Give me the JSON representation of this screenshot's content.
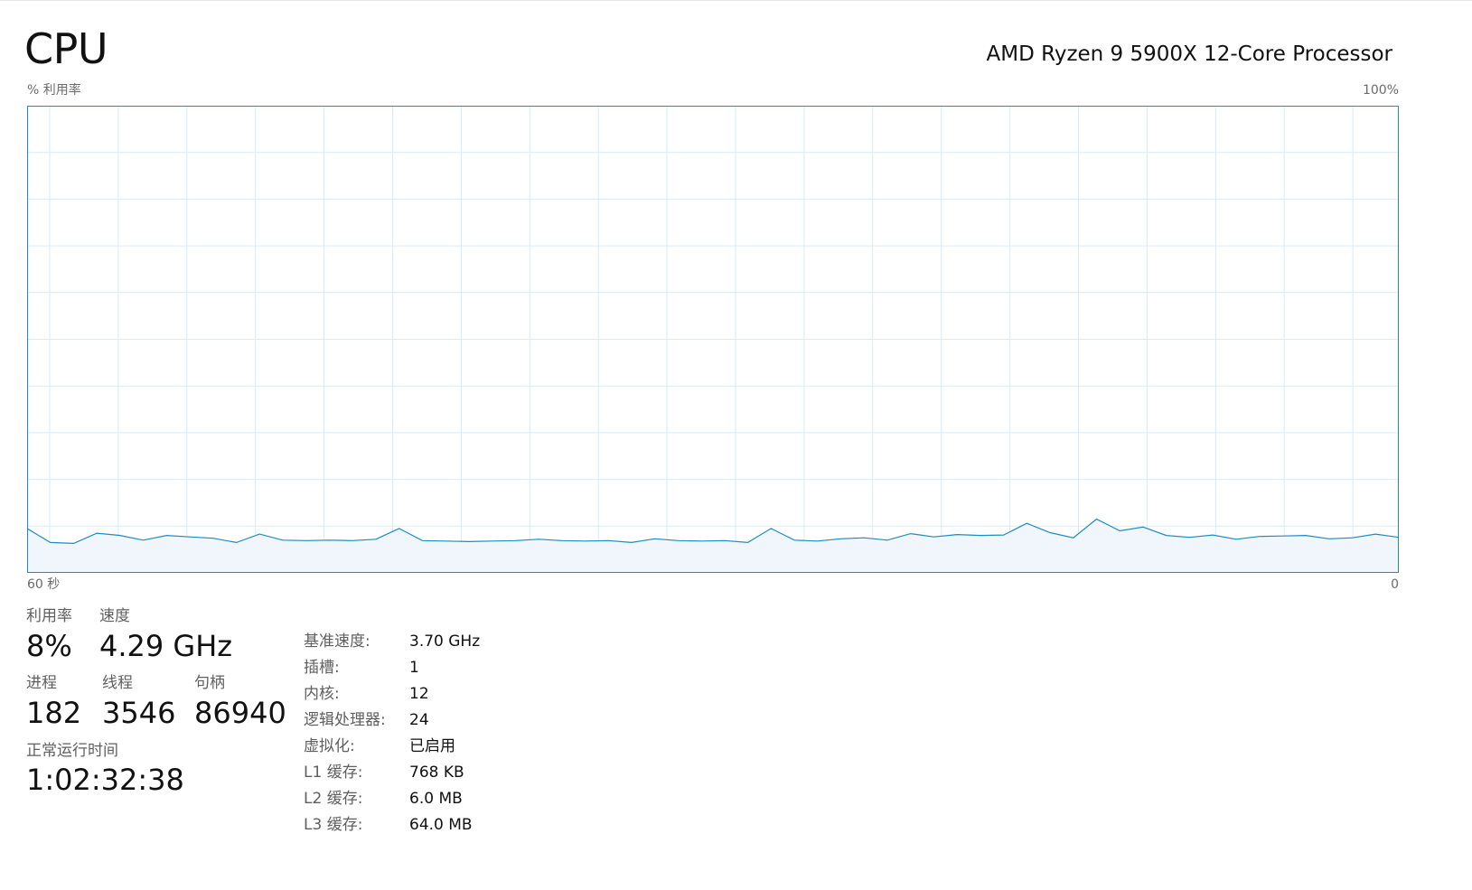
{
  "header": {
    "title": "CPU",
    "processor_name": "AMD Ryzen 9 5900X 12-Core Processor"
  },
  "graph": {
    "y_label": "% 利用率",
    "y_max_label": "100%",
    "x_left_label": "60 秒",
    "x_right_label": "0",
    "line_color": "#1c8cc4",
    "fill_color": "#f0f6fb",
    "grid_color": "#d9ebf5",
    "border_color": "#1c8cc4",
    "y_range": [
      0,
      100
    ],
    "x_range_seconds": [
      60,
      0
    ],
    "grid_rows": 10,
    "grid_cols": 20,
    "samples": [
      9.5,
      6.5,
      6.3,
      8.5,
      8.0,
      7.0,
      8.0,
      7.7,
      7.4,
      6.5,
      8.3,
      7.0,
      6.9,
      7.0,
      6.9,
      7.2,
      9.5,
      6.9,
      6.8,
      6.7,
      6.8,
      6.9,
      7.2,
      6.9,
      6.8,
      6.9,
      6.5,
      7.3,
      6.9,
      6.8,
      6.9,
      6.5,
      9.5,
      7.0,
      6.8,
      7.3,
      7.5,
      7.0,
      8.4,
      7.7,
      8.2,
      8.0,
      8.1,
      10.6,
      8.6,
      7.5,
      11.5,
      9.0,
      9.8,
      8.0,
      7.6,
      8.1,
      7.2,
      7.8,
      7.9,
      8.0,
      7.3,
      7.5,
      8.3,
      7.6
    ]
  },
  "stats": {
    "utilization_label": "利用率",
    "utilization_value": "8%",
    "speed_label": "速度",
    "speed_value": "4.29 GHz",
    "processes_label": "进程",
    "processes_value": "182",
    "threads_label": "线程",
    "threads_value": "3546",
    "handles_label": "句柄",
    "handles_value": "86940",
    "uptime_label": "正常运行时间",
    "uptime_value": "1:02:32:38"
  },
  "info": [
    {
      "key": "基准速度:",
      "value": "3.70 GHz"
    },
    {
      "key": "插槽:",
      "value": "1"
    },
    {
      "key": "内核:",
      "value": "12"
    },
    {
      "key": "逻辑处理器:",
      "value": "24"
    },
    {
      "key": "虚拟化:",
      "value": "已启用"
    },
    {
      "key": "L1 缓存:",
      "value": "768 KB"
    },
    {
      "key": "L2 缓存:",
      "value": "6.0 MB"
    },
    {
      "key": "L3 缓存:",
      "value": "64.0 MB"
    }
  ]
}
